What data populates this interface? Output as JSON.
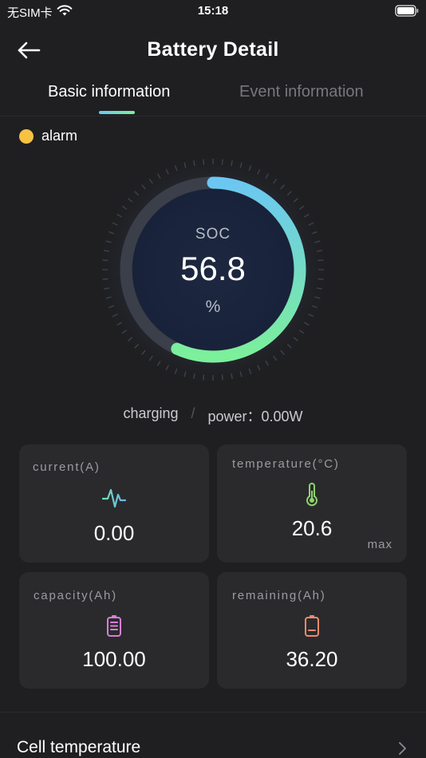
{
  "status_bar": {
    "carrier": "无SIM卡",
    "time": "15:18",
    "icons": [
      "wifi-icon",
      "battery-icon"
    ]
  },
  "nav": {
    "title": "Battery Detail",
    "back_icon": "arrow-left-icon"
  },
  "tabs": [
    {
      "label": "Basic information",
      "active": true
    },
    {
      "label": "Event information",
      "active": false
    }
  ],
  "alarm": {
    "label": "alarm",
    "color": "#f5c242"
  },
  "gauge": {
    "label": "SOC",
    "value": "56.8",
    "unit": "%",
    "percent": 56.8,
    "gradient_start": "#6bc7f2",
    "gradient_end": "#7cf09a"
  },
  "charge_status": {
    "state": "charging",
    "separator": "/",
    "power_label": "power：0.00W"
  },
  "cards": [
    {
      "label": "current(A)",
      "value": "0.00",
      "icon": "waveform-icon"
    },
    {
      "label": "temperature(°C)",
      "value": "20.6",
      "extra": "max",
      "icon": "thermometer-icon"
    },
    {
      "label": "capacity(Ah)",
      "value": "100.00",
      "icon": "battery-full-icon"
    },
    {
      "label": "remaining(Ah)",
      "value": "36.20",
      "icon": "battery-low-icon"
    }
  ],
  "cell_temperature": {
    "label": "Cell temperature",
    "chevron_icon": "chevron-right-icon"
  },
  "colors": {
    "background": "#1f1f21",
    "card": "#2a2a2d",
    "accent_blue": "#6bc7f2",
    "accent_green": "#7cf09a"
  }
}
